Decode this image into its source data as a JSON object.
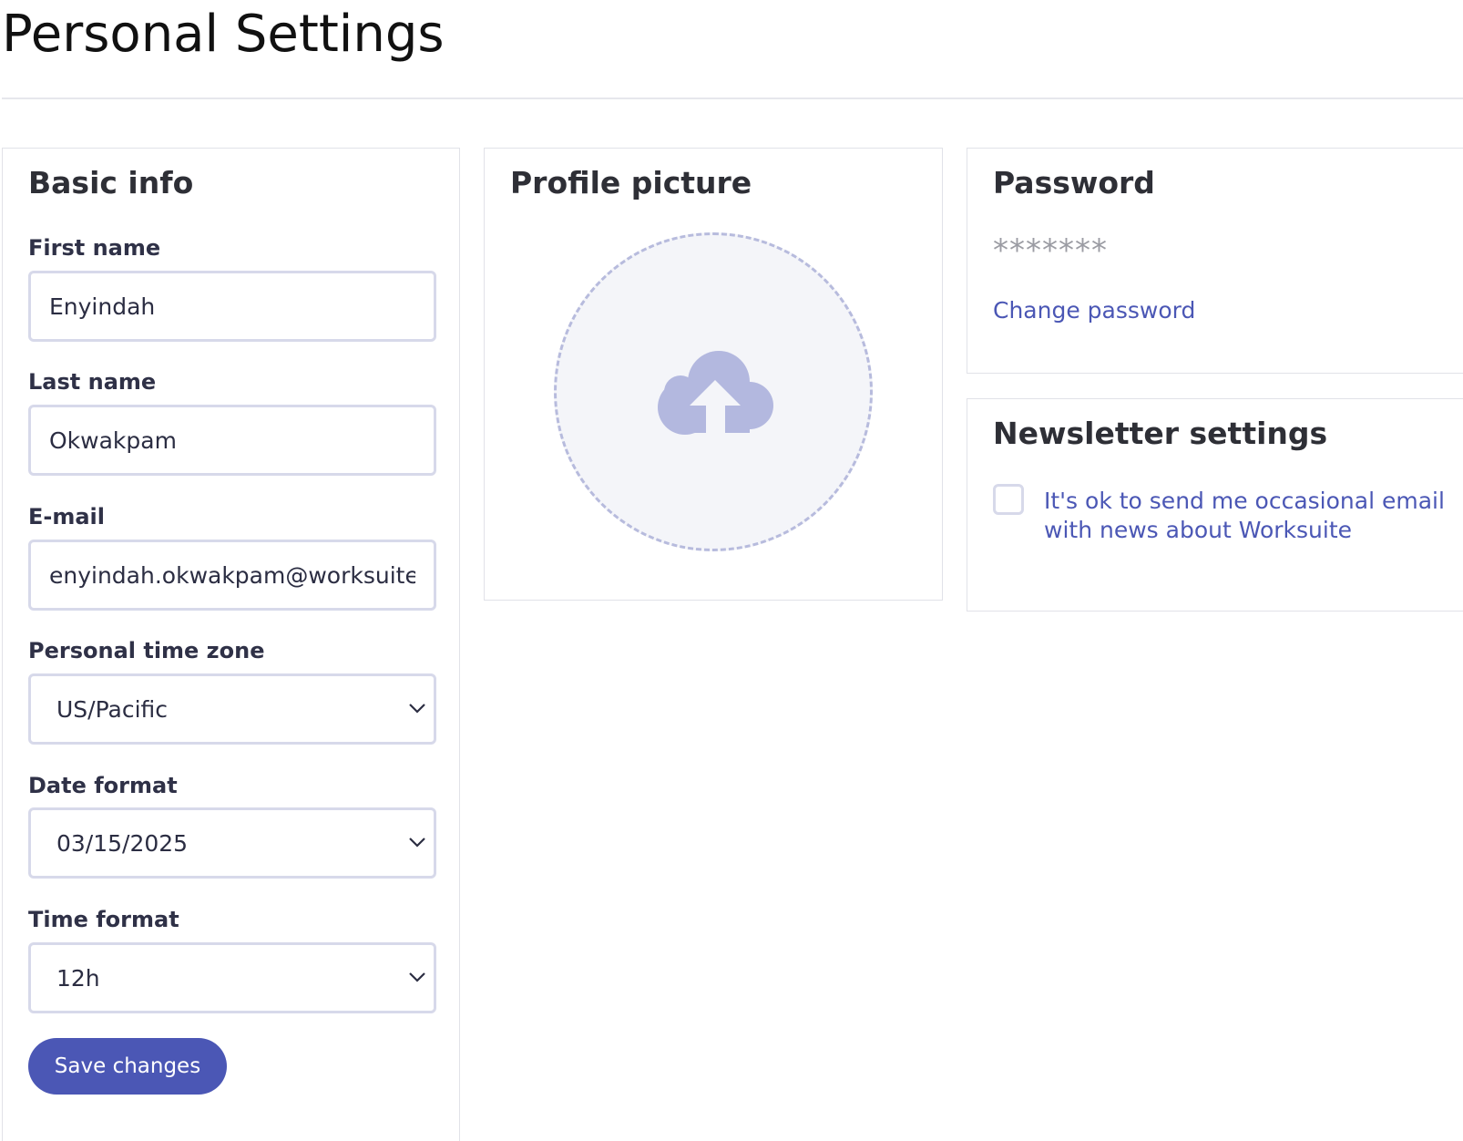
{
  "page": {
    "title": "Personal Settings"
  },
  "basic_info": {
    "title": "Basic info",
    "first_name_label": "First name",
    "first_name_value": "Enyindah",
    "last_name_label": "Last name",
    "last_name_value": "Okwakpam",
    "email_label": "E-mail",
    "email_value": "enyindah.okwakpam@worksuite.com",
    "timezone_label": "Personal time zone",
    "timezone_value": "US/Pacific",
    "date_format_label": "Date format",
    "date_format_value": "03/15/2025",
    "time_format_label": "Time format",
    "time_format_value": "12h",
    "save_label": "Save changes"
  },
  "profile_picture": {
    "title": "Profile picture",
    "icon": "cloud-upload-icon"
  },
  "password": {
    "title": "Password",
    "masked_value": "*******",
    "change_link": "Change password"
  },
  "newsletter": {
    "title": "Newsletter settings",
    "checkbox_label": "It's ok to send me occasional email with news about Worksuite",
    "checked": false
  },
  "colors": {
    "accent": "#4b57b5",
    "field_border": "#d7d9ea",
    "upload_icon": "#b3b8df",
    "upload_bg": "#f4f5f9"
  }
}
